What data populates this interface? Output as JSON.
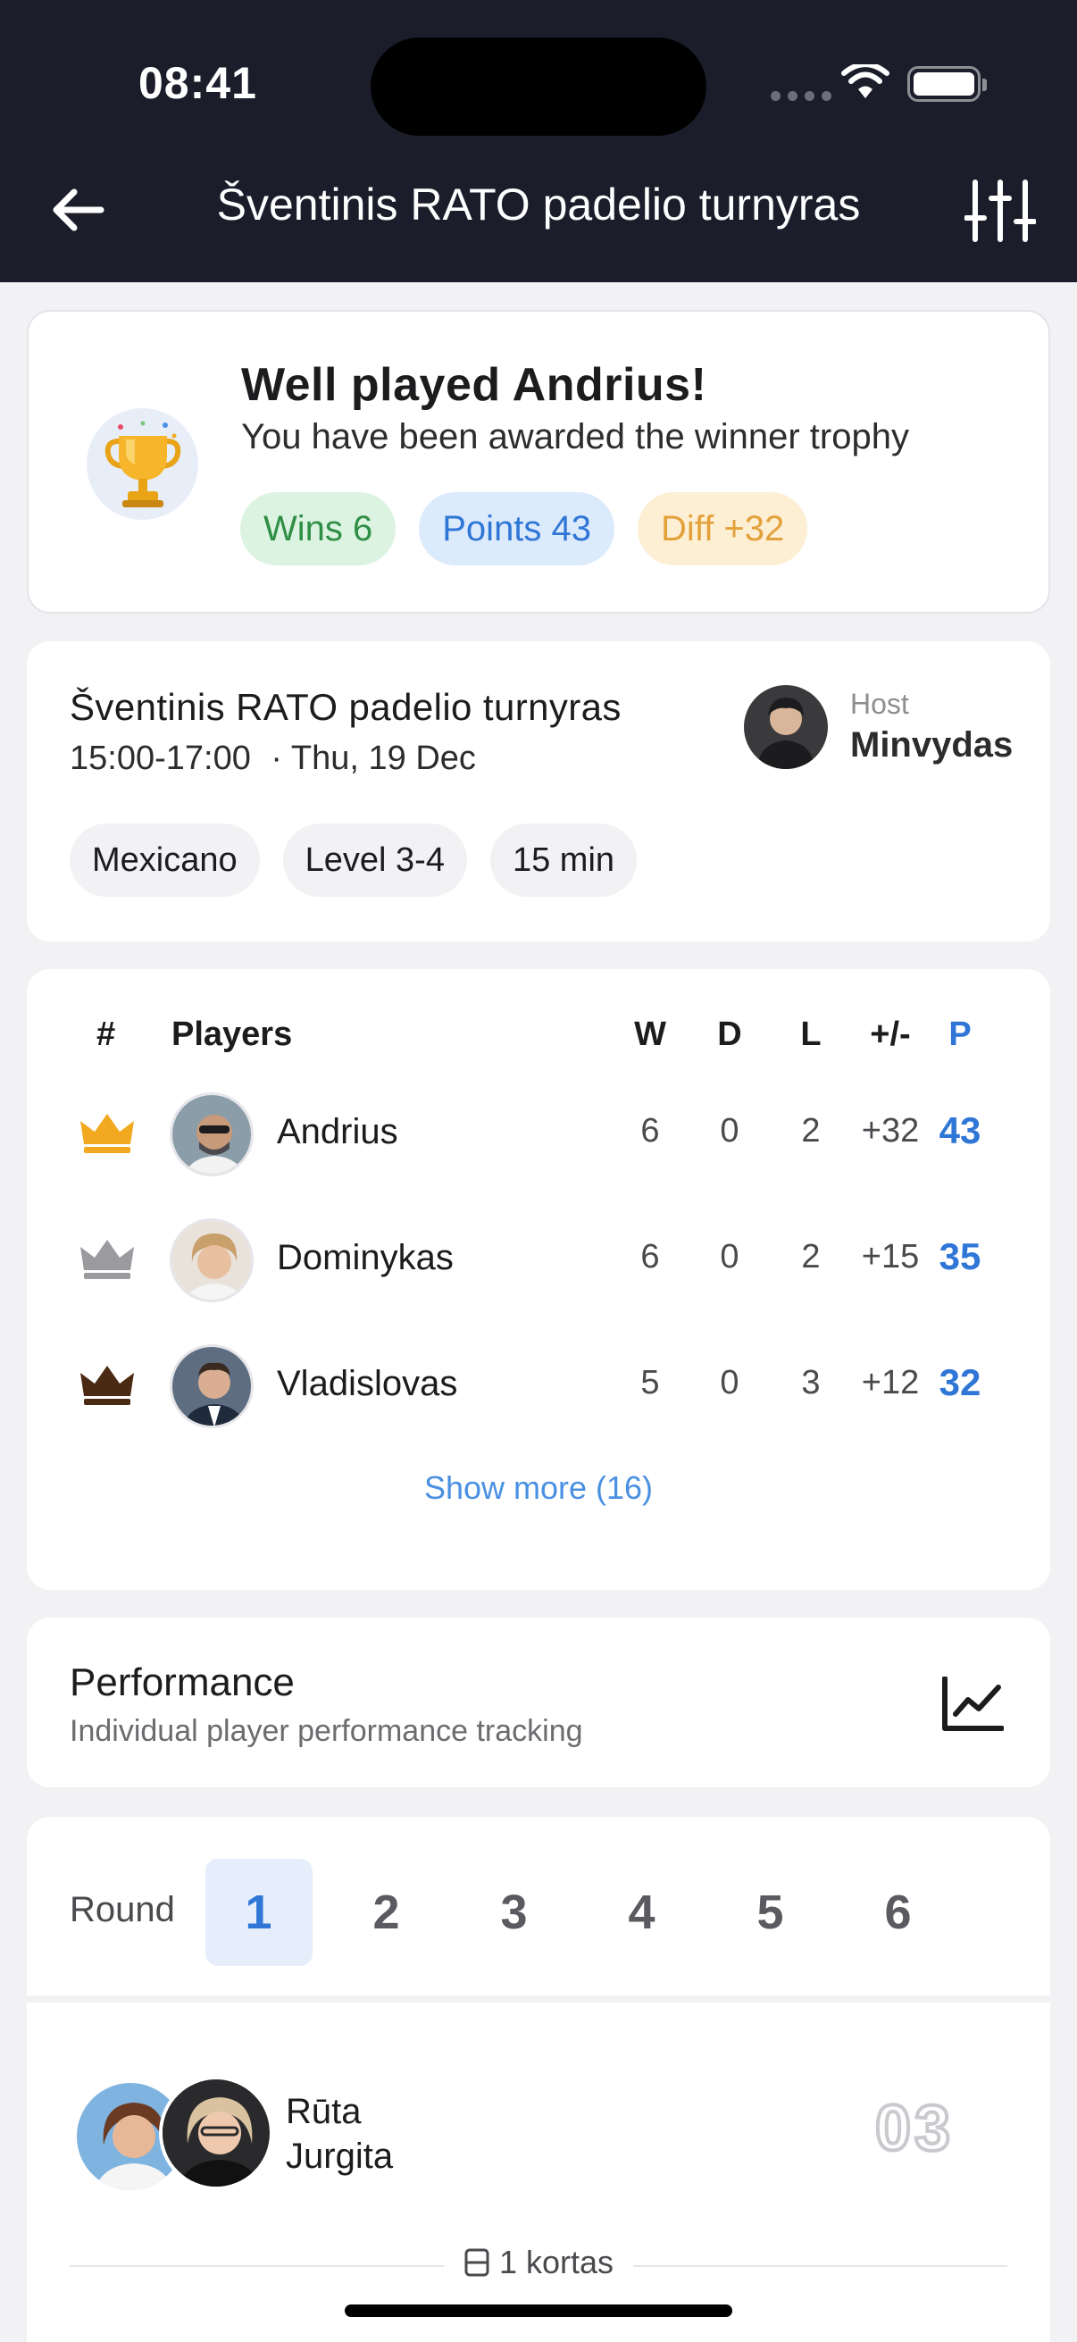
{
  "status_bar": {
    "time": "08:41"
  },
  "header": {
    "title": "Šventinis RATO padelio turnyras"
  },
  "winner": {
    "title": "Well played Andrius!",
    "subtitle": "You have been awarded the winner trophy",
    "pills": {
      "wins": "Wins 6",
      "points": "Points 43",
      "diff": "Diff +32"
    }
  },
  "event": {
    "title": "Šventinis RATO padelio turnyras",
    "time": "15:00-17:00",
    "date": "· Thu, 19 Dec",
    "host_label": "Host",
    "host_name": "Minvydas",
    "tags": [
      "Mexicano",
      "Level 3-4",
      "15 min"
    ]
  },
  "standings": {
    "headers": {
      "rank": "#",
      "players": "Players",
      "w": "W",
      "d": "D",
      "l": "L",
      "diff": "+/-",
      "p": "P"
    },
    "rows": [
      {
        "name": "Andrius",
        "w": "6",
        "d": "0",
        "l": "2",
        "diff": "+32",
        "p": "43",
        "crown": "gold"
      },
      {
        "name": "Dominykas",
        "w": "6",
        "d": "0",
        "l": "2",
        "diff": "+15",
        "p": "35",
        "crown": "silver"
      },
      {
        "name": "Vladislovas",
        "w": "5",
        "d": "0",
        "l": "3",
        "diff": "+12",
        "p": "32",
        "crown": "bronze"
      }
    ],
    "show_more": "Show more (16)"
  },
  "performance": {
    "title": "Performance",
    "subtitle": "Individual player performance tracking"
  },
  "rounds": {
    "label": "Round",
    "items": [
      "1",
      "2",
      "3",
      "4",
      "5",
      "6"
    ],
    "active": "1"
  },
  "match": {
    "player1": "Rūta",
    "player2": "Jurgita",
    "score": "03",
    "court": "1 kortas"
  },
  "colors": {
    "header_bg": "#1B1D2B",
    "accent_blue": "#2F76D6",
    "gold": "#F2A91F",
    "silver": "#9A9A9F",
    "bronze": "#4A2A12"
  }
}
